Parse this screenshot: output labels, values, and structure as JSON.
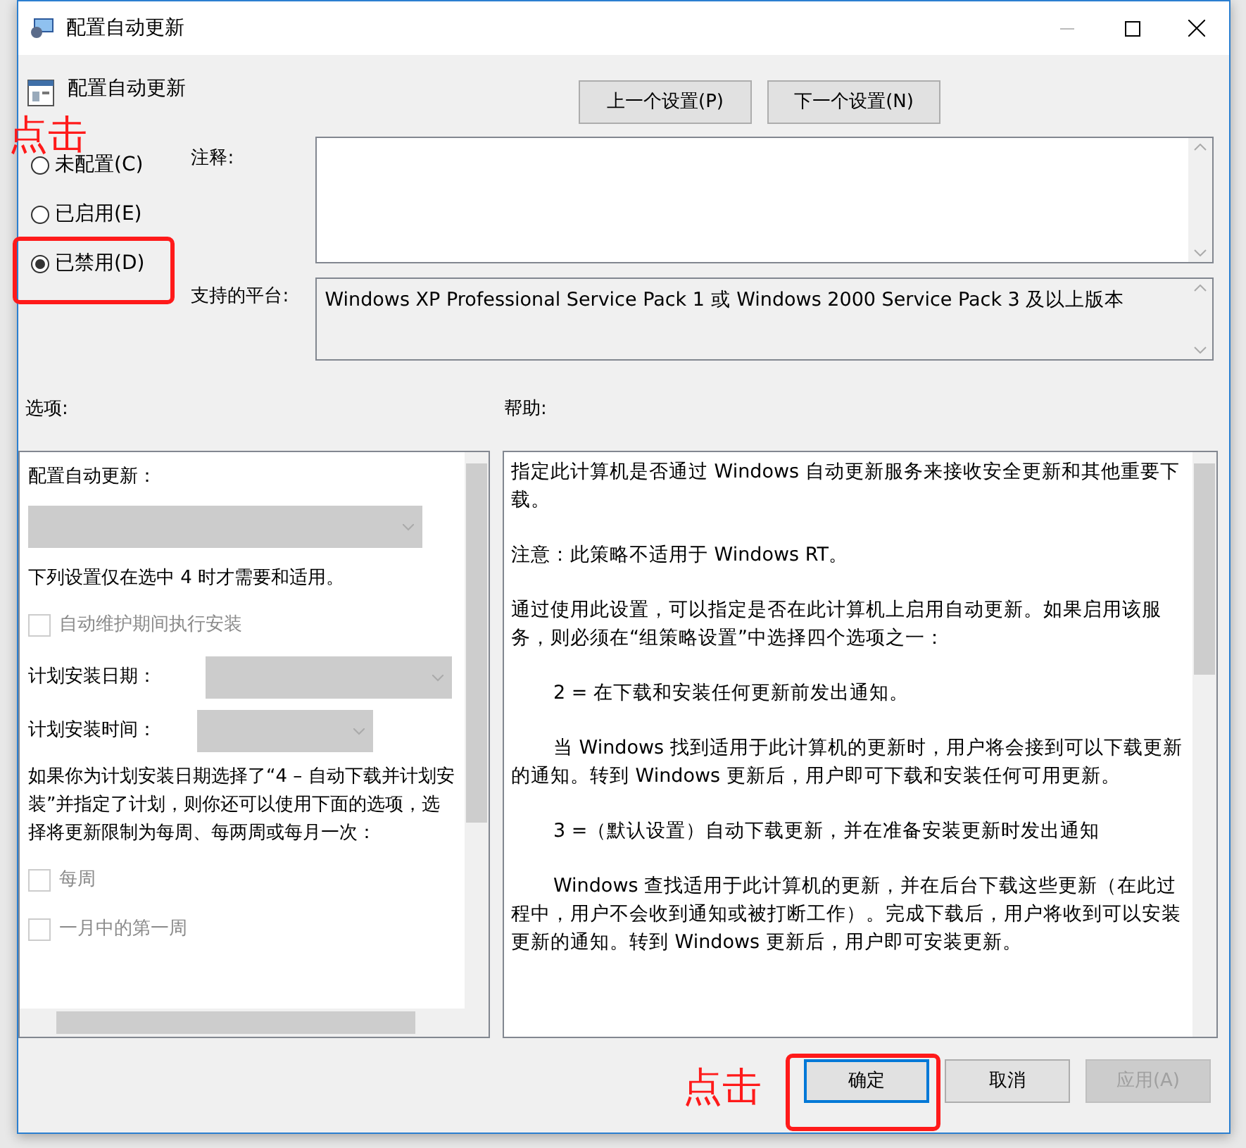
{
  "window": {
    "title": "配置自动更新"
  },
  "header": {
    "title": "配置自动更新",
    "buttons": [
      "上一个设置(P)",
      "下一个设置(N)"
    ]
  },
  "state_options": [
    {
      "label": "未配置(C)",
      "selected": false
    },
    {
      "label": "已启用(E)",
      "selected": false
    },
    {
      "label": "已禁用(D)",
      "selected": true
    }
  ],
  "comment": {
    "label": "注释:"
  },
  "platform": {
    "label": "支持的平台:",
    "value": "Windows XP Professional Service Pack 1 或 Windows 2000 Service Pack 3 及以上版本"
  },
  "options": {
    "label": "选项:",
    "items": [
      {
        "kind": "text",
        "text": "配置自动更新："
      },
      {
        "kind": "select",
        "disabled": true
      },
      {
        "kind": "text",
        "text": "下列设置仅在选中 4 时才需要和适用。"
      },
      {
        "kind": "checkbox",
        "label": "自动维护期间执行安装",
        "checked": false,
        "disabled": true
      },
      {
        "kind": "labeled-select",
        "label": "计划安装日期：",
        "disabled": true
      },
      {
        "kind": "labeled-select",
        "label": "计划安装时间：",
        "disabled": true
      },
      {
        "kind": "text",
        "text": "如果你为计划安装日期选择了“4 – 自动下载并计划安装”并指定了计划，则你还可以使用下面的选项，选择将更新限制为每周、每两周或每月一次："
      },
      {
        "kind": "checkbox",
        "label": "每周",
        "checked": false,
        "disabled": true
      },
      {
        "kind": "checkbox",
        "label": "一月中的第一周",
        "checked": false,
        "disabled": true
      }
    ]
  },
  "help": {
    "label": "帮助:",
    "paragraphs": [
      {
        "text": "指定此计算机是否通过 Windows 自动更新服务来接收安全更新和其他重要下载。",
        "indented": false
      },
      {
        "text": "注意：此策略不适用于 Windows RT。",
        "indented": false
      },
      {
        "text": "通过使用此设置，可以指定是否在此计算机上启用自动更新。如果启用该服务，则必须在“组策略设置”中选择四个选项之一：",
        "indented": false
      },
      {
        "text": "2 = 在下载和安装任何更新前发出通知。",
        "indented": true
      },
      {
        "text": "当 Windows 找到适用于此计算机的更新时，用户将会接到可以下载更新的通知。转到 Windows 更新后，用户即可下载和安装任何可用更新。",
        "indented": true
      },
      {
        "text": "3 =（默认设置）自动下载更新，并在准备安装更新时发出通知",
        "indented": true
      },
      {
        "text": "Windows 查找适用于此计算机的更新，并在后台下载这些更新（在此过程中，用户不会收到通知或被打断工作）。完成下载后，用户将收到可以安装更新的通知。转到 Windows 更新后，用户即可安装更新。",
        "indented": true
      }
    ]
  },
  "footer": {
    "buttons": [
      {
        "label": "确定",
        "default": true,
        "disabled": false
      },
      {
        "label": "取消",
        "default": false,
        "disabled": false
      },
      {
        "label": "应用(A)",
        "default": false,
        "disabled": true
      }
    ]
  },
  "annotations": [
    {
      "kind": "text",
      "text": "点击"
    },
    {
      "kind": "box"
    },
    {
      "kind": "text",
      "text": "点击"
    },
    {
      "kind": "box"
    }
  ]
}
